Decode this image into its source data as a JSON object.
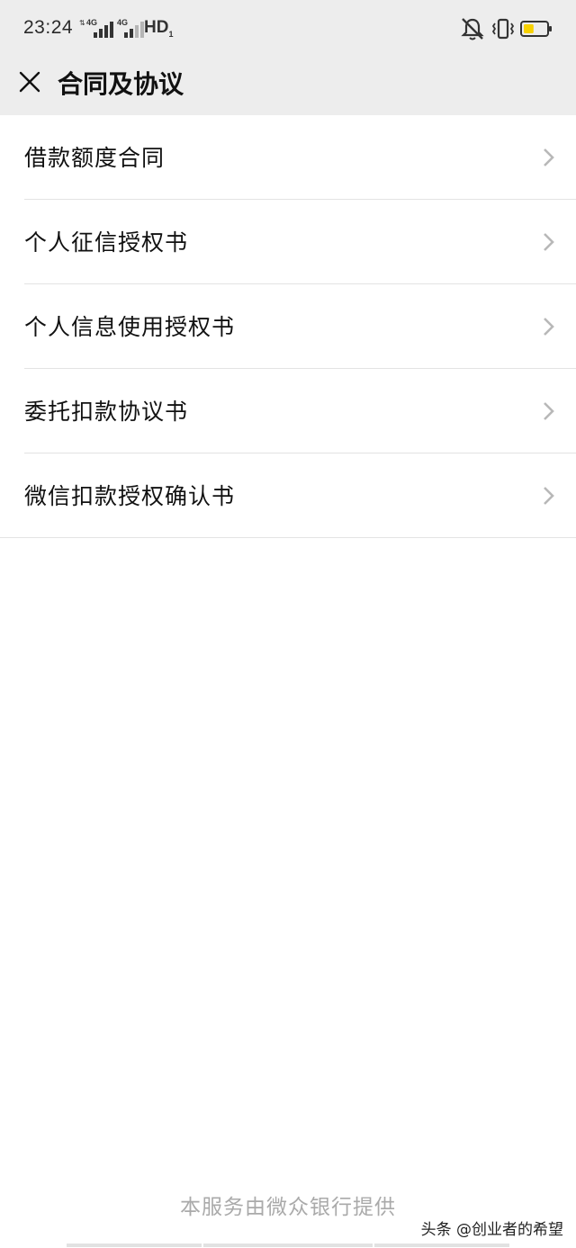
{
  "status_bar": {
    "time": "23:24",
    "sim1_label": "4G",
    "sim2_label": "4G",
    "hd_label": "HD",
    "hd_sub": "1",
    "icons": [
      "mute-icon",
      "vibrate-icon",
      "battery-icon"
    ],
    "battery_level": 0.45,
    "battery_color": "#f7d100"
  },
  "nav": {
    "close_icon": "close-icon",
    "title": "合同及协议"
  },
  "list": {
    "items": [
      {
        "label": "借款额度合同"
      },
      {
        "label": "个人征信授权书"
      },
      {
        "label": "个人信息使用授权书"
      },
      {
        "label": "委托扣款协议书"
      },
      {
        "label": "微信扣款授权确认书"
      }
    ],
    "chevron_icon": "chevron-right-icon"
  },
  "footer": {
    "text": "本服务由微众银行提供",
    "watermark": "头条 @创业者的希望"
  },
  "colors": {
    "header_bg": "#ededed",
    "page_bg": "#ffffff",
    "footer_text": "#aaaaaa"
  }
}
